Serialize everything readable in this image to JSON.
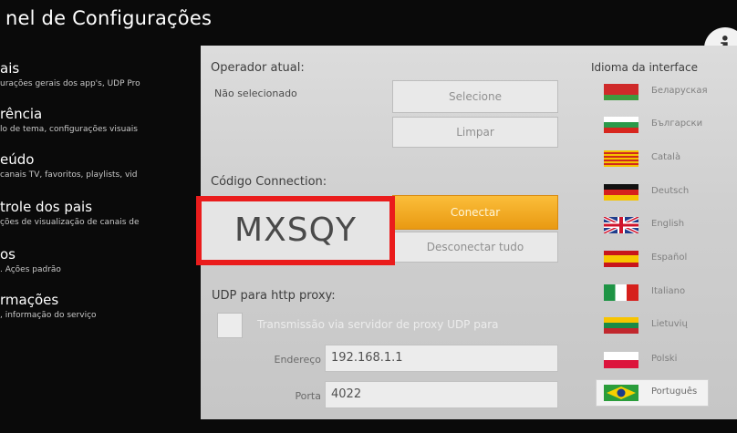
{
  "header": {
    "title": "nel de Configurações"
  },
  "sidebar": {
    "items": [
      {
        "label": "ais",
        "sub": "urações gerais dos app's, UDP Pro"
      },
      {
        "label": "rência",
        "sub": "lo de tema, configurações visuais"
      },
      {
        "label": "eúdo",
        "sub": "canais TV, favoritos, playlists, vid"
      },
      {
        "label": "trole dos pais",
        "sub": "ções de visualização de canais de"
      },
      {
        "label": "os",
        "sub": ". Ações padrão"
      },
      {
        "label": "rmações",
        "sub": ", informação do serviço"
      }
    ]
  },
  "operator": {
    "label": "Operador atual:",
    "value": "Não selecionado",
    "select_button": "Selecione",
    "clear_button": "Limpar"
  },
  "connection": {
    "label": "Código Connection:",
    "code": "MXSQY",
    "connect_button": "Conectar",
    "disconnect_button": "Desconectar tudo"
  },
  "udp": {
    "label": "UDP para http proxy:",
    "checkbox_label": "Transmissão via servidor de proxy UDP para",
    "address_label": "Endereço",
    "address_value": "192.168.1.1",
    "port_label": "Porta",
    "port_value": "4022"
  },
  "languages": {
    "label": "Idioma da interface",
    "items": [
      {
        "name": "Беларуская",
        "icon": "flag-by-icon"
      },
      {
        "name": "Български",
        "icon": "flag-bg-icon"
      },
      {
        "name": "Català",
        "icon": "flag-ca-icon"
      },
      {
        "name": "Deutsch",
        "icon": "flag-de-icon"
      },
      {
        "name": "English",
        "icon": "flag-gb-icon"
      },
      {
        "name": "Español",
        "icon": "flag-es-icon"
      },
      {
        "name": "Italiano",
        "icon": "flag-it-icon"
      },
      {
        "name": "Lietuvių",
        "icon": "flag-lt-icon"
      },
      {
        "name": "Polski",
        "icon": "flag-pl-icon"
      },
      {
        "name": "Português",
        "icon": "flag-br-icon"
      }
    ],
    "selected": "Português"
  },
  "colors": {
    "highlight": "#ea1c1c",
    "accent_button": "#f5a623",
    "panel_bg": "#d4d4d4",
    "background": "#0a0a0a"
  }
}
